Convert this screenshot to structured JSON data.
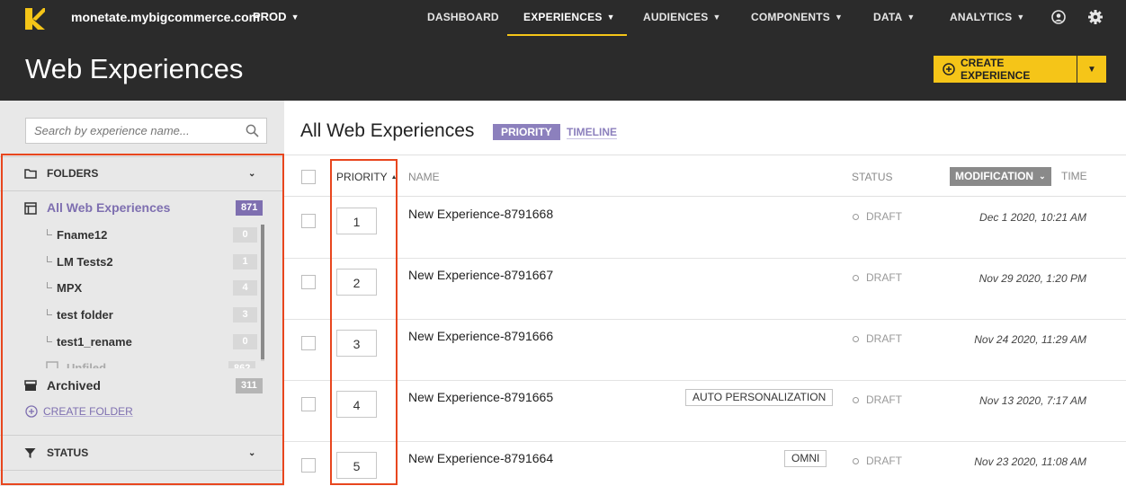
{
  "topnav": {
    "site": "monetate.mybigcommerce.com",
    "env": "PROD",
    "items": [
      "DASHBOARD",
      "EXPERIENCES",
      "AUDIENCES",
      "COMPONENTS",
      "DATA",
      "ANALYTICS"
    ],
    "active": "EXPERIENCES",
    "accent": "#f5c518"
  },
  "header": {
    "title": "Web Experiences",
    "create_button": "CREATE EXPERIENCE"
  },
  "sidebar": {
    "search_placeholder": "Search by experience name...",
    "folders_label": "FOLDERS",
    "all_label": "All Web Experiences",
    "all_count": "871",
    "folders": [
      {
        "name": "Fname12",
        "count": "0"
      },
      {
        "name": "LM Tests2",
        "count": "1"
      },
      {
        "name": "MPX",
        "count": "4"
      },
      {
        "name": "test folder",
        "count": "3"
      },
      {
        "name": "test1_rename",
        "count": "0"
      }
    ],
    "unfiled_label": "Unfiled",
    "unfiled_count": "862",
    "archived_label": "Archived",
    "archived_count": "311",
    "create_folder": "CREATE FOLDER",
    "status_label": "STATUS"
  },
  "main": {
    "title": "All Web Experiences",
    "tab_priority": "PRIORITY",
    "tab_timeline": "TIMELINE",
    "columns": {
      "priority": "PRIORITY",
      "name": "NAME",
      "status": "STATUS",
      "modification": "MODIFICATION",
      "time": "TIME"
    },
    "rows": [
      {
        "priority": "1",
        "name": "New Experience-8791668",
        "tag": "",
        "status": "DRAFT",
        "time": "Dec 1 2020, 10:21 AM"
      },
      {
        "priority": "2",
        "name": "New Experience-8791667",
        "tag": "",
        "status": "DRAFT",
        "time": "Nov 29 2020, 1:20 PM"
      },
      {
        "priority": "3",
        "name": "New Experience-8791666",
        "tag": "",
        "status": "DRAFT",
        "time": "Nov 24 2020, 11:29 AM"
      },
      {
        "priority": "4",
        "name": "New Experience-8791665",
        "tag": "AUTO PERSONALIZATION",
        "status": "DRAFT",
        "time": "Nov 13 2020, 7:17 AM"
      },
      {
        "priority": "5",
        "name": "New Experience-8791664",
        "tag": "OMNI",
        "status": "DRAFT",
        "time": "Nov 23 2020, 11:08 AM"
      }
    ]
  },
  "colors": {
    "purple": "#7e6fb0",
    "highlight": "#e8461e",
    "dark_bg": "#2b2b2b"
  }
}
